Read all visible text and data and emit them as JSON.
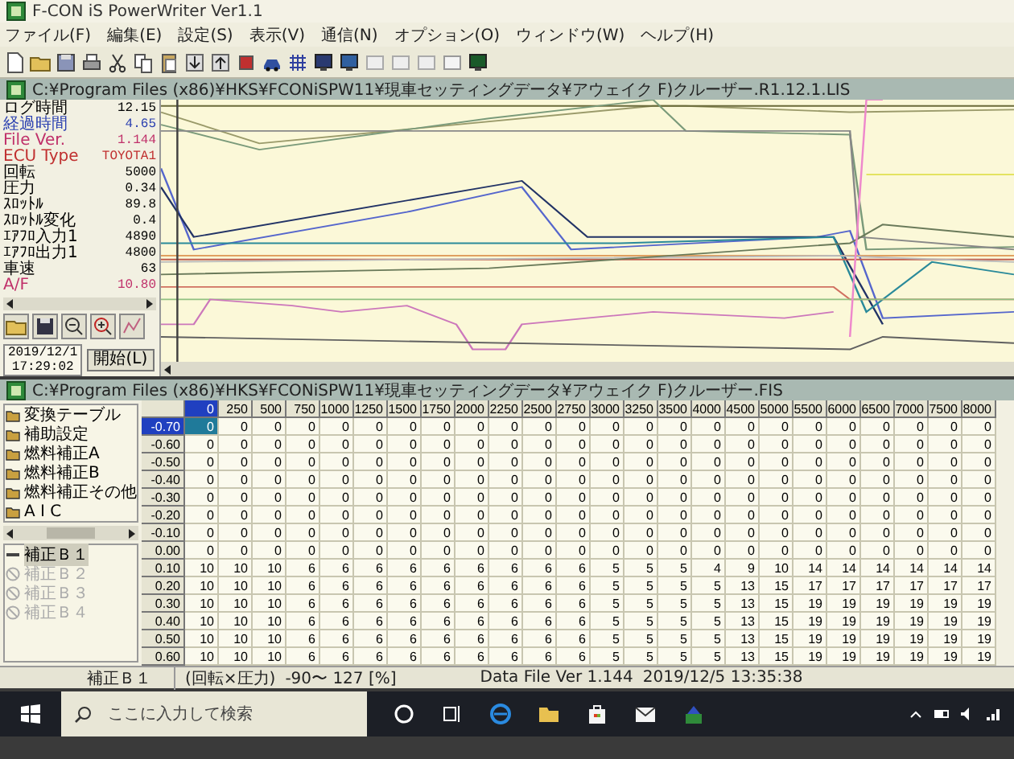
{
  "app": {
    "title": "F-CON iS PowerWriter Ver1.1"
  },
  "menu": [
    "ファイル(F)",
    "編集(E)",
    "設定(S)",
    "表示(V)",
    "通信(N)",
    "オプション(O)",
    "ウィンドウ(W)",
    "ヘルプ(H)"
  ],
  "log_window": {
    "title": "C:¥Program Files (x86)¥HKS¥FCONiSPW11¥現車セッティングデータ¥アウェイク F)クルーザー.R1.12.1.LIS",
    "items": [
      {
        "label": "ログ時間",
        "value": "12.15",
        "color": "#000000"
      },
      {
        "label": "経過時間",
        "value": "4.65",
        "color": "#2a3fb0"
      },
      {
        "label": "File Ver.",
        "value": "1.144",
        "color": "#c0306a"
      },
      {
        "label": "ECU Type",
        "value": "TOYOTA1",
        "color": "#c03030"
      },
      {
        "label": "回転",
        "value": "5000",
        "color": "#000000"
      },
      {
        "label": "圧力",
        "value": "0.34",
        "color": "#000000"
      },
      {
        "label": "ｽﾛｯﾄﾙ",
        "value": "89.8",
        "color": "#000000"
      },
      {
        "label": "ｽﾛｯﾄﾙ変化",
        "value": "0.4",
        "color": "#000000"
      },
      {
        "label": "ｴｱﾌﾛ入力1",
        "value": "4890",
        "color": "#000000"
      },
      {
        "label": "ｴｱﾌﾛ出力1",
        "value": "4800",
        "color": "#000000"
      },
      {
        "label": "車速",
        "value": "63",
        "color": "#000000"
      },
      {
        "label": "A/F",
        "value": "10.80",
        "color": "#c0306a"
      }
    ],
    "date": "2019/12/1",
    "time": "17:29:02",
    "start_button": "開始(L)"
  },
  "map_window": {
    "title": "C:¥Program Files (x86)¥HKS¥FCONiSPW11¥現車セッティングデータ¥アウェイク F)クルーザー.FIS",
    "tree": [
      "変換テーブル",
      "補助設定",
      "燃料補正A",
      "燃料補正B",
      "燃料補正その他",
      "A I C"
    ],
    "list": [
      {
        "label": "補正Ｂ１",
        "selected": true,
        "disabled": false
      },
      {
        "label": "補正Ｂ２",
        "selected": false,
        "disabled": true
      },
      {
        "label": "補正Ｂ３",
        "selected": false,
        "disabled": true
      },
      {
        "label": "補正Ｂ４",
        "selected": false,
        "disabled": true
      }
    ],
    "columns": [
      {
        "label": "0",
        "selected": true
      },
      {
        "label": "250",
        "selected": false
      },
      {
        "label": "500",
        "selected": false
      },
      {
        "label": "750",
        "selected": false
      },
      {
        "label": "1000",
        "selected": false
      },
      {
        "label": "1250",
        "selected": false
      },
      {
        "label": "1500",
        "selected": false
      },
      {
        "label": "1750",
        "selected": false
      },
      {
        "label": "2000",
        "selected": false
      },
      {
        "label": "2250",
        "selected": false
      },
      {
        "label": "2500",
        "selected": false
      },
      {
        "label": "2750",
        "selected": false
      },
      {
        "label": "3000",
        "selected": false
      },
      {
        "label": "3250",
        "selected": false
      },
      {
        "label": "3500",
        "selected": false
      },
      {
        "label": "4000",
        "selected": false
      },
      {
        "label": "4500",
        "selected": false
      },
      {
        "label": "5000",
        "selected": false
      },
      {
        "label": "5500",
        "selected": false
      },
      {
        "label": "6000",
        "selected": false
      },
      {
        "label": "6500",
        "selected": false
      },
      {
        "label": "7000",
        "selected": false
      },
      {
        "label": "7500",
        "selected": false
      },
      {
        "label": "8000",
        "selected": false
      }
    ],
    "rows": [
      {
        "label": "-0.70",
        "selected": true,
        "cells": [
          "0",
          "0",
          "0",
          "0",
          "0",
          "0",
          "0",
          "0",
          "0",
          "0",
          "0",
          "0",
          "0",
          "0",
          "0",
          "0",
          "0",
          "0",
          "0",
          "0",
          "0",
          "0",
          "0",
          "0"
        ]
      },
      {
        "label": "-0.60",
        "selected": false,
        "cells": [
          "0",
          "0",
          "0",
          "0",
          "0",
          "0",
          "0",
          "0",
          "0",
          "0",
          "0",
          "0",
          "0",
          "0",
          "0",
          "0",
          "0",
          "0",
          "0",
          "0",
          "0",
          "0",
          "0",
          "0"
        ]
      },
      {
        "label": "-0.50",
        "selected": false,
        "cells": [
          "0",
          "0",
          "0",
          "0",
          "0",
          "0",
          "0",
          "0",
          "0",
          "0",
          "0",
          "0",
          "0",
          "0",
          "0",
          "0",
          "0",
          "0",
          "0",
          "0",
          "0",
          "0",
          "0",
          "0"
        ]
      },
      {
        "label": "-0.40",
        "selected": false,
        "cells": [
          "0",
          "0",
          "0",
          "0",
          "0",
          "0",
          "0",
          "0",
          "0",
          "0",
          "0",
          "0",
          "0",
          "0",
          "0",
          "0",
          "0",
          "0",
          "0",
          "0",
          "0",
          "0",
          "0",
          "0"
        ]
      },
      {
        "label": "-0.30",
        "selected": false,
        "cells": [
          "0",
          "0",
          "0",
          "0",
          "0",
          "0",
          "0",
          "0",
          "0",
          "0",
          "0",
          "0",
          "0",
          "0",
          "0",
          "0",
          "0",
          "0",
          "0",
          "0",
          "0",
          "0",
          "0",
          "0"
        ]
      },
      {
        "label": "-0.20",
        "selected": false,
        "cells": [
          "0",
          "0",
          "0",
          "0",
          "0",
          "0",
          "0",
          "0",
          "0",
          "0",
          "0",
          "0",
          "0",
          "0",
          "0",
          "0",
          "0",
          "0",
          "0",
          "0",
          "0",
          "0",
          "0",
          "0"
        ]
      },
      {
        "label": "-0.10",
        "selected": false,
        "cells": [
          "0",
          "0",
          "0",
          "0",
          "0",
          "0",
          "0",
          "0",
          "0",
          "0",
          "0",
          "0",
          "0",
          "0",
          "0",
          "0",
          "0",
          "0",
          "0",
          "0",
          "0",
          "0",
          "0",
          "0"
        ]
      },
      {
        "label": "0.00",
        "selected": false,
        "cells": [
          "0",
          "0",
          "0",
          "0",
          "0",
          "0",
          "0",
          "0",
          "0",
          "0",
          "0",
          "0",
          "0",
          "0",
          "0",
          "0",
          "0",
          "0",
          "0",
          "0",
          "0",
          "0",
          "0",
          "0"
        ]
      },
      {
        "label": "0.10",
        "selected": false,
        "cells": [
          "10",
          "10",
          "10",
          "6",
          "6",
          "6",
          "6",
          "6",
          "6",
          "6",
          "6",
          "6",
          "5",
          "5",
          "5",
          "4",
          "9",
          "10",
          "14",
          "14",
          "14",
          "14",
          "14",
          "14"
        ]
      },
      {
        "label": "0.20",
        "selected": false,
        "cells": [
          "10",
          "10",
          "10",
          "6",
          "6",
          "6",
          "6",
          "6",
          "6",
          "6",
          "6",
          "6",
          "5",
          "5",
          "5",
          "5",
          "13",
          "15",
          "17",
          "17",
          "17",
          "17",
          "17",
          "17"
        ]
      },
      {
        "label": "0.30",
        "selected": false,
        "cells": [
          "10",
          "10",
          "10",
          "6",
          "6",
          "6",
          "6",
          "6",
          "6",
          "6",
          "6",
          "6",
          "5",
          "5",
          "5",
          "5",
          "13",
          "15",
          "19",
          "19",
          "19",
          "19",
          "19",
          "19"
        ]
      },
      {
        "label": "0.40",
        "selected": false,
        "cells": [
          "10",
          "10",
          "10",
          "6",
          "6",
          "6",
          "6",
          "6",
          "6",
          "6",
          "6",
          "6",
          "5",
          "5",
          "5",
          "5",
          "13",
          "15",
          "19",
          "19",
          "19",
          "19",
          "19",
          "19"
        ]
      },
      {
        "label": "0.50",
        "selected": false,
        "cells": [
          "10",
          "10",
          "10",
          "6",
          "6",
          "6",
          "6",
          "6",
          "6",
          "6",
          "6",
          "6",
          "5",
          "5",
          "5",
          "5",
          "13",
          "15",
          "19",
          "19",
          "19",
          "19",
          "19",
          "19"
        ]
      },
      {
        "label": "0.60",
        "selected": false,
        "cells": [
          "10",
          "10",
          "10",
          "6",
          "6",
          "6",
          "6",
          "6",
          "6",
          "6",
          "6",
          "6",
          "5",
          "5",
          "5",
          "5",
          "13",
          "15",
          "19",
          "19",
          "19",
          "19",
          "19",
          "19"
        ]
      }
    ]
  },
  "status_bar": [
    "補正Ｂ１",
    "(回転×圧力)",
    "-90〜 127 [%]",
    "Data File Ver 1.144",
    "2019/12/5 13:35:38"
  ],
  "taskbar": {
    "search_placeholder": "ここに入力して検索"
  }
}
